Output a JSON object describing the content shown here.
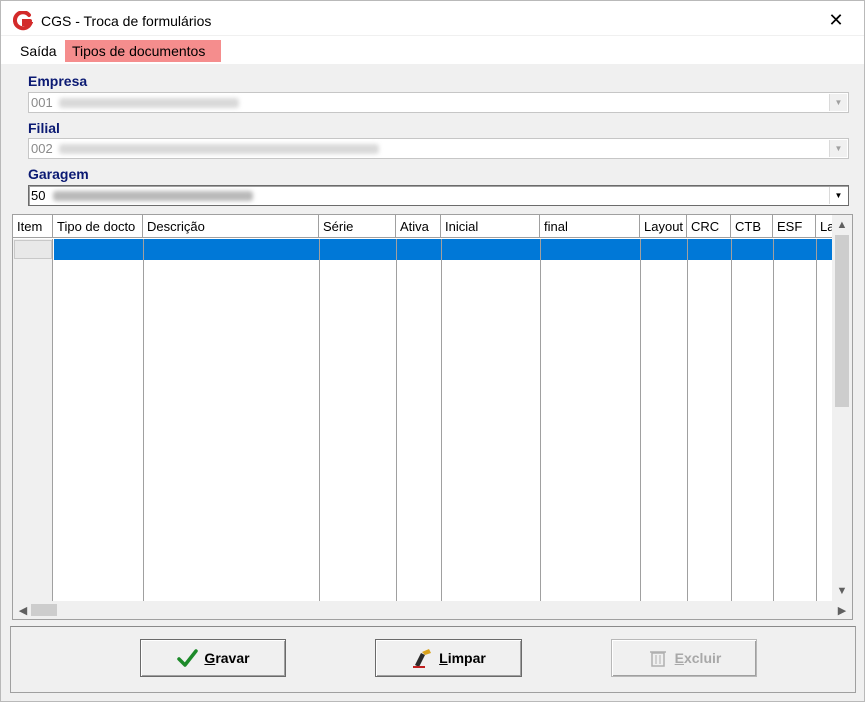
{
  "window": {
    "title": "CGS - Troca de formulários",
    "close_glyph": "✕",
    "app_icon": "cgs-logo-icon"
  },
  "menu": {
    "items": [
      "Saída",
      "Tipos de documentos"
    ],
    "highlighted": "Tipos de documentos",
    "highlight_color": "#f58d8d"
  },
  "form": {
    "empresa": {
      "label": "Empresa",
      "value": "001"
    },
    "filial": {
      "label": "Filial",
      "value": "002"
    },
    "garagem": {
      "label": "Garagem",
      "value": "50"
    }
  },
  "grid": {
    "columns": [
      "Item",
      "Tipo de docto",
      "Descrição",
      "Série",
      "Ativa",
      "Inicial",
      "final",
      "Layout",
      "CRC",
      "CTB",
      "ESF",
      "La"
    ],
    "selected_row_color": "#0078d7"
  },
  "buttons": {
    "gravar": {
      "label_first": "G",
      "label_rest": "ravar",
      "icon": "checkmark-icon",
      "enabled": true
    },
    "limpar": {
      "label_first": "L",
      "label_rest": "impar",
      "icon": "eraser-icon",
      "enabled": true
    },
    "excluir": {
      "label_first": "E",
      "label_rest": "xcluir",
      "icon": "trash-icon",
      "enabled": false
    }
  }
}
